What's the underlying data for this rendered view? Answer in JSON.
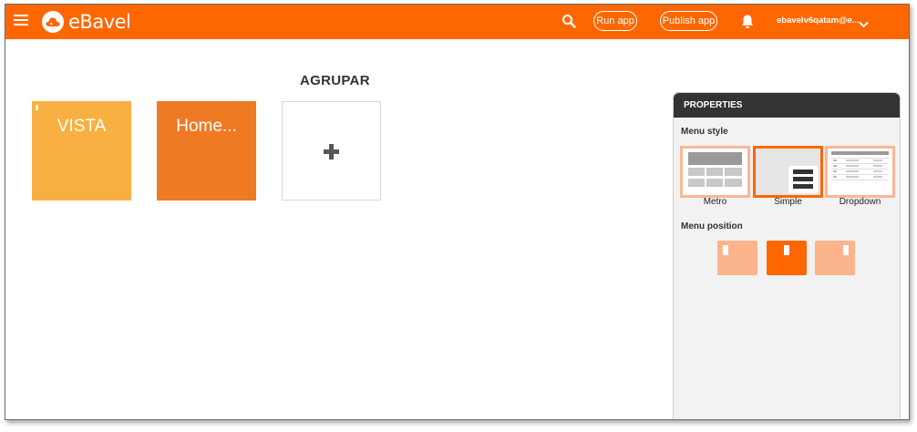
{
  "header": {
    "app_name": "eBavel",
    "run_label": "Run app",
    "publish_label": "Publish app",
    "user_label": "ebavelv6qatam@e...",
    "accent_color": "#fe6700"
  },
  "canvas": {
    "group_title": "AGRUPAR",
    "tiles": [
      {
        "label": "VISTA",
        "color": "#f9b042"
      },
      {
        "label": "Home...",
        "color": "#ef7a24"
      }
    ],
    "add_icon": "plus-icon"
  },
  "properties": {
    "title": "PROPERTIES",
    "menu_style_title": "Menu style",
    "menu_styles": [
      {
        "label": "Metro",
        "selected": false
      },
      {
        "label": "Simple",
        "selected": true
      },
      {
        "label": "Dropdown",
        "selected": false
      }
    ],
    "menu_position_title": "Menu position",
    "menu_positions": [
      {
        "name": "left",
        "selected": false
      },
      {
        "name": "center",
        "selected": true
      },
      {
        "name": "right",
        "selected": false
      }
    ]
  }
}
